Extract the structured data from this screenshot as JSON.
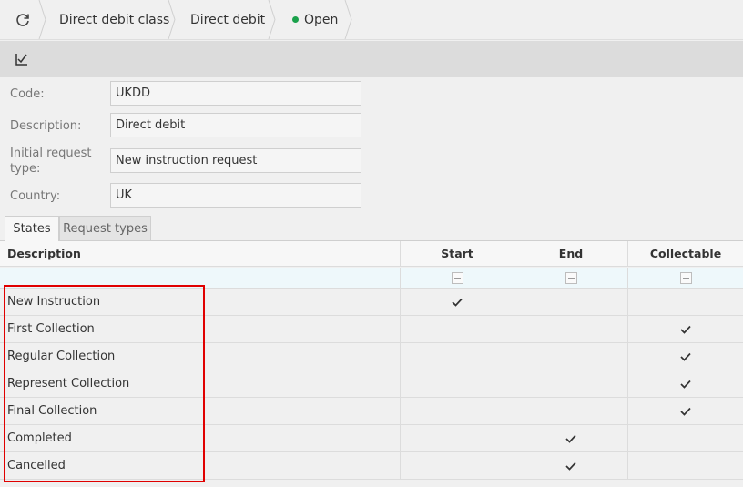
{
  "breadcrumb": {
    "items": [
      "Direct debit class",
      "Direct debit"
    ],
    "status": "Open",
    "status_color": "#1aa14b"
  },
  "icons": {
    "refresh": "refresh-icon",
    "edit": "edit-check-icon",
    "checkmark": "check-icon"
  },
  "form": {
    "code_label": "Code:",
    "code_value": "UKDD",
    "description_label": "Description:",
    "description_value": "Direct debit",
    "initial_request_label_line1": "Initial request",
    "initial_request_label_line2": "type:",
    "initial_request_value": "New instruction request",
    "country_label": "Country:",
    "country_value": "UK"
  },
  "tabs": [
    {
      "label": "States",
      "active": true
    },
    {
      "label": "Request types",
      "active": false
    }
  ],
  "grid": {
    "columns": [
      "Description",
      "Start",
      "End",
      "Collectable"
    ],
    "rows": [
      {
        "description": "New Instruction",
        "start": true,
        "end": false,
        "collectable": false
      },
      {
        "description": "First Collection",
        "start": false,
        "end": false,
        "collectable": true
      },
      {
        "description": "Regular Collection",
        "start": false,
        "end": false,
        "collectable": true
      },
      {
        "description": "Represent Collection",
        "start": false,
        "end": false,
        "collectable": true
      },
      {
        "description": "Final Collection",
        "start": false,
        "end": false,
        "collectable": true
      },
      {
        "description": "Completed",
        "start": false,
        "end": true,
        "collectable": false
      },
      {
        "description": "Cancelled",
        "start": false,
        "end": true,
        "collectable": false
      }
    ]
  },
  "colors": {
    "highlight": "#e00000"
  }
}
